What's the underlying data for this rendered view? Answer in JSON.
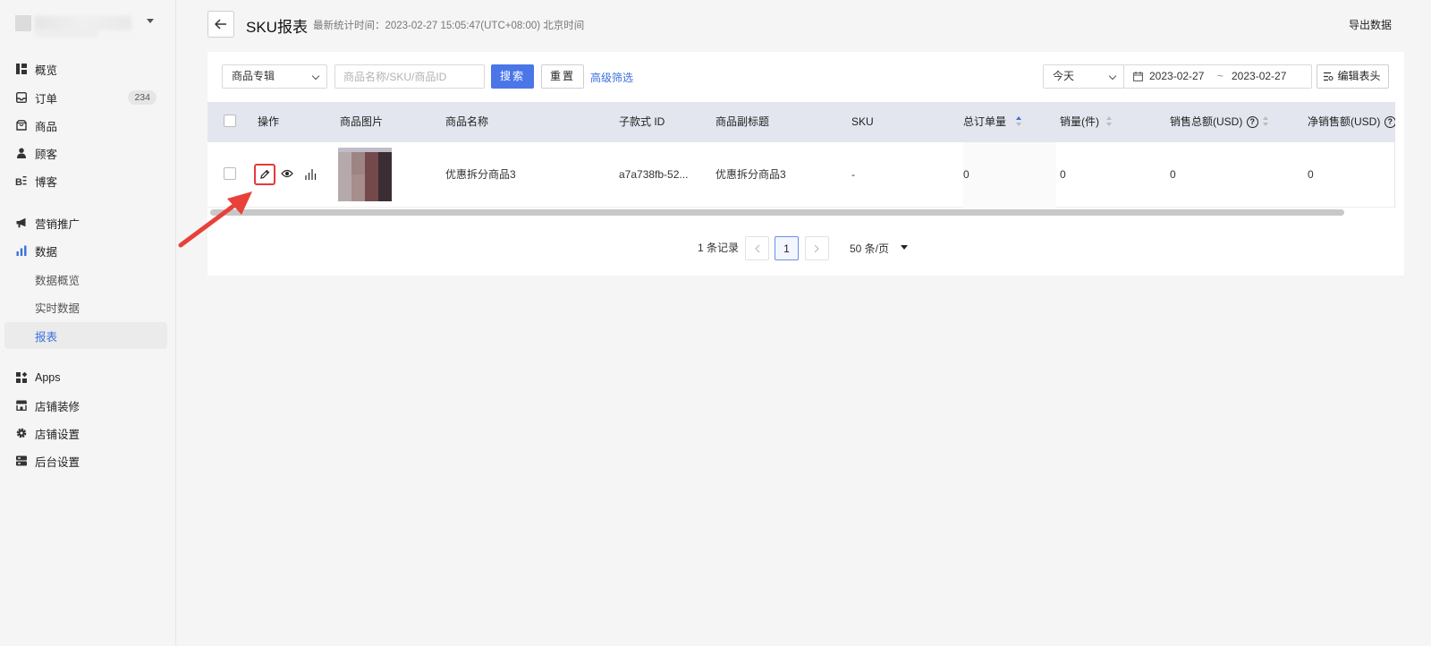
{
  "sidebar": {
    "items": [
      {
        "label": "概览",
        "icon": "overview-icon"
      },
      {
        "label": "订单",
        "icon": "inbox-icon",
        "badge": "234"
      },
      {
        "label": "商品",
        "icon": "product-icon"
      },
      {
        "label": "顾客",
        "icon": "user-icon"
      },
      {
        "label": "博客",
        "icon": "blog-icon"
      },
      {
        "label": "营销推广",
        "icon": "megaphone-icon"
      },
      {
        "label": "数据",
        "icon": "bar-chart-icon"
      },
      {
        "label": "数据概览"
      },
      {
        "label": "实时数据"
      },
      {
        "label": "报表",
        "active": true
      },
      {
        "label": "Apps",
        "icon": "apps-icon"
      },
      {
        "label": "店铺装修",
        "icon": "store-icon"
      },
      {
        "label": "店铺设置",
        "icon": "gear-icon"
      },
      {
        "label": "后台设置",
        "icon": "server-icon"
      }
    ]
  },
  "header": {
    "title": "SKU报表",
    "stat_time": "最新统计时间：2023-02-27 15:05:47(UTC+08:00) 北京时间",
    "export_label": "导出数据"
  },
  "filters": {
    "collection_select": "商品专辑",
    "search_placeholder": "商品名称/SKU/商品ID",
    "search_button": "搜索",
    "reset_button": "重置",
    "advanced_link": "高级筛选",
    "period_select": "今天",
    "date_start": "2023-02-27",
    "date_sep": "~",
    "date_end": "2023-02-27",
    "edit_columns": "编辑表头"
  },
  "table": {
    "columns": [
      "操作",
      "商品图片",
      "商品名称",
      "子款式 ID",
      "商品副标题",
      "SKU",
      "总订单量",
      "销量(件)",
      "销售总额(USD)",
      "净销售额(USD)"
    ],
    "rows": [
      {
        "name": "优惠拆分商品3",
        "variant_id": "a7a738fb-52...",
        "subtitle": "优惠拆分商品3",
        "sku": "-",
        "total_orders": "0",
        "sales_qty": "0",
        "gross_sales": "0",
        "net_sales": "0"
      }
    ]
  },
  "pagination": {
    "total": "1 条记录",
    "current_page": "1",
    "page_size": "50 条/页"
  },
  "colors": {
    "accent": "#4a76e8",
    "highlight": "#e23b3b",
    "header_bg": "#e3e6ee"
  }
}
